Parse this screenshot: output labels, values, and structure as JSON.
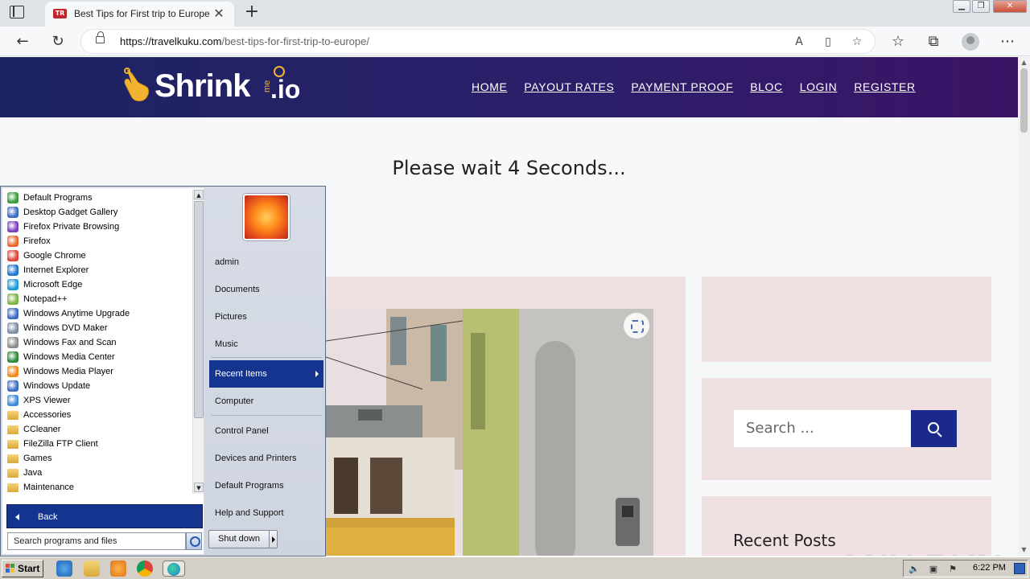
{
  "browser": {
    "tab_title": "Best Tips for First trip to Europe",
    "tab_favicon_text": "TR",
    "url_host": "https://travelkuku.com",
    "url_path": "/best-tips-for-first-trip-to-europe/"
  },
  "site": {
    "logo_text": "Shrink",
    "logo_me": "me",
    "logo_io": ".io",
    "nav": [
      "HOME",
      "PAYOUT RATES",
      "PAYMENT PROOF",
      "BLOC",
      "LOGIN",
      "REGISTER"
    ],
    "wait_message": "Please wait  4  Seconds...",
    "search_placeholder": "Search ...",
    "recent_posts_title": "Recent Posts",
    "watermark": "ANY RUN"
  },
  "start_menu": {
    "programs": [
      {
        "label": "Default Programs",
        "icon": "default-programs-icon",
        "color": "#3b9a3b"
      },
      {
        "label": "Desktop Gadget Gallery",
        "icon": "gadget-icon",
        "color": "#3d6cc4"
      },
      {
        "label": "Firefox Private Browsing",
        "icon": "firefox-private-icon",
        "color": "#7b3fc0"
      },
      {
        "label": "Firefox",
        "icon": "firefox-icon",
        "color": "#e8652b"
      },
      {
        "label": "Google Chrome",
        "icon": "chrome-icon",
        "color": "#db4437"
      },
      {
        "label": "Internet Explorer",
        "icon": "ie-icon",
        "color": "#1f77d0"
      },
      {
        "label": "Microsoft Edge",
        "icon": "edge-icon",
        "color": "#1a9ad6"
      },
      {
        "label": "Notepad++",
        "icon": "notepadpp-icon",
        "color": "#7cb342"
      },
      {
        "label": "Windows Anytime Upgrade",
        "icon": "windows-icon",
        "color": "#3d6cc4"
      },
      {
        "label": "Windows DVD Maker",
        "icon": "dvd-icon",
        "color": "#7d8ea8"
      },
      {
        "label": "Windows Fax and Scan",
        "icon": "fax-icon",
        "color": "#8c8c8c"
      },
      {
        "label": "Windows Media Center",
        "icon": "media-center-icon",
        "color": "#2e8b3a"
      },
      {
        "label": "Windows Media Player",
        "icon": "media-player-icon",
        "color": "#f08a1c"
      },
      {
        "label": "Windows Update",
        "icon": "windows-update-icon",
        "color": "#3d6cc4"
      },
      {
        "label": "XPS Viewer",
        "icon": "xps-icon",
        "color": "#3d8ad6"
      },
      {
        "label": "Accessories",
        "icon": "folder-icon",
        "color": "folder"
      },
      {
        "label": "CCleaner",
        "icon": "folder-icon",
        "color": "folder"
      },
      {
        "label": "FileZilla FTP Client",
        "icon": "folder-icon",
        "color": "folder"
      },
      {
        "label": "Games",
        "icon": "folder-icon",
        "color": "folder"
      },
      {
        "label": "Java",
        "icon": "folder-icon",
        "color": "folder"
      },
      {
        "label": "Maintenance",
        "icon": "folder-icon",
        "color": "folder"
      }
    ],
    "back_label": "Back",
    "search_placeholder": "Search programs and files",
    "right_items": [
      {
        "label": "admin"
      },
      {
        "label": "Documents"
      },
      {
        "label": "Pictures"
      },
      {
        "label": "Music"
      },
      {
        "label": "Recent Items",
        "selected": true
      },
      {
        "label": "Computer"
      },
      {
        "label": "Control Panel"
      },
      {
        "label": "Devices and Printers"
      },
      {
        "label": "Default Programs"
      },
      {
        "label": "Help and Support"
      }
    ],
    "shutdown_label": "Shut down"
  },
  "taskbar": {
    "start_label": "Start",
    "clock": "6:22 PM"
  }
}
